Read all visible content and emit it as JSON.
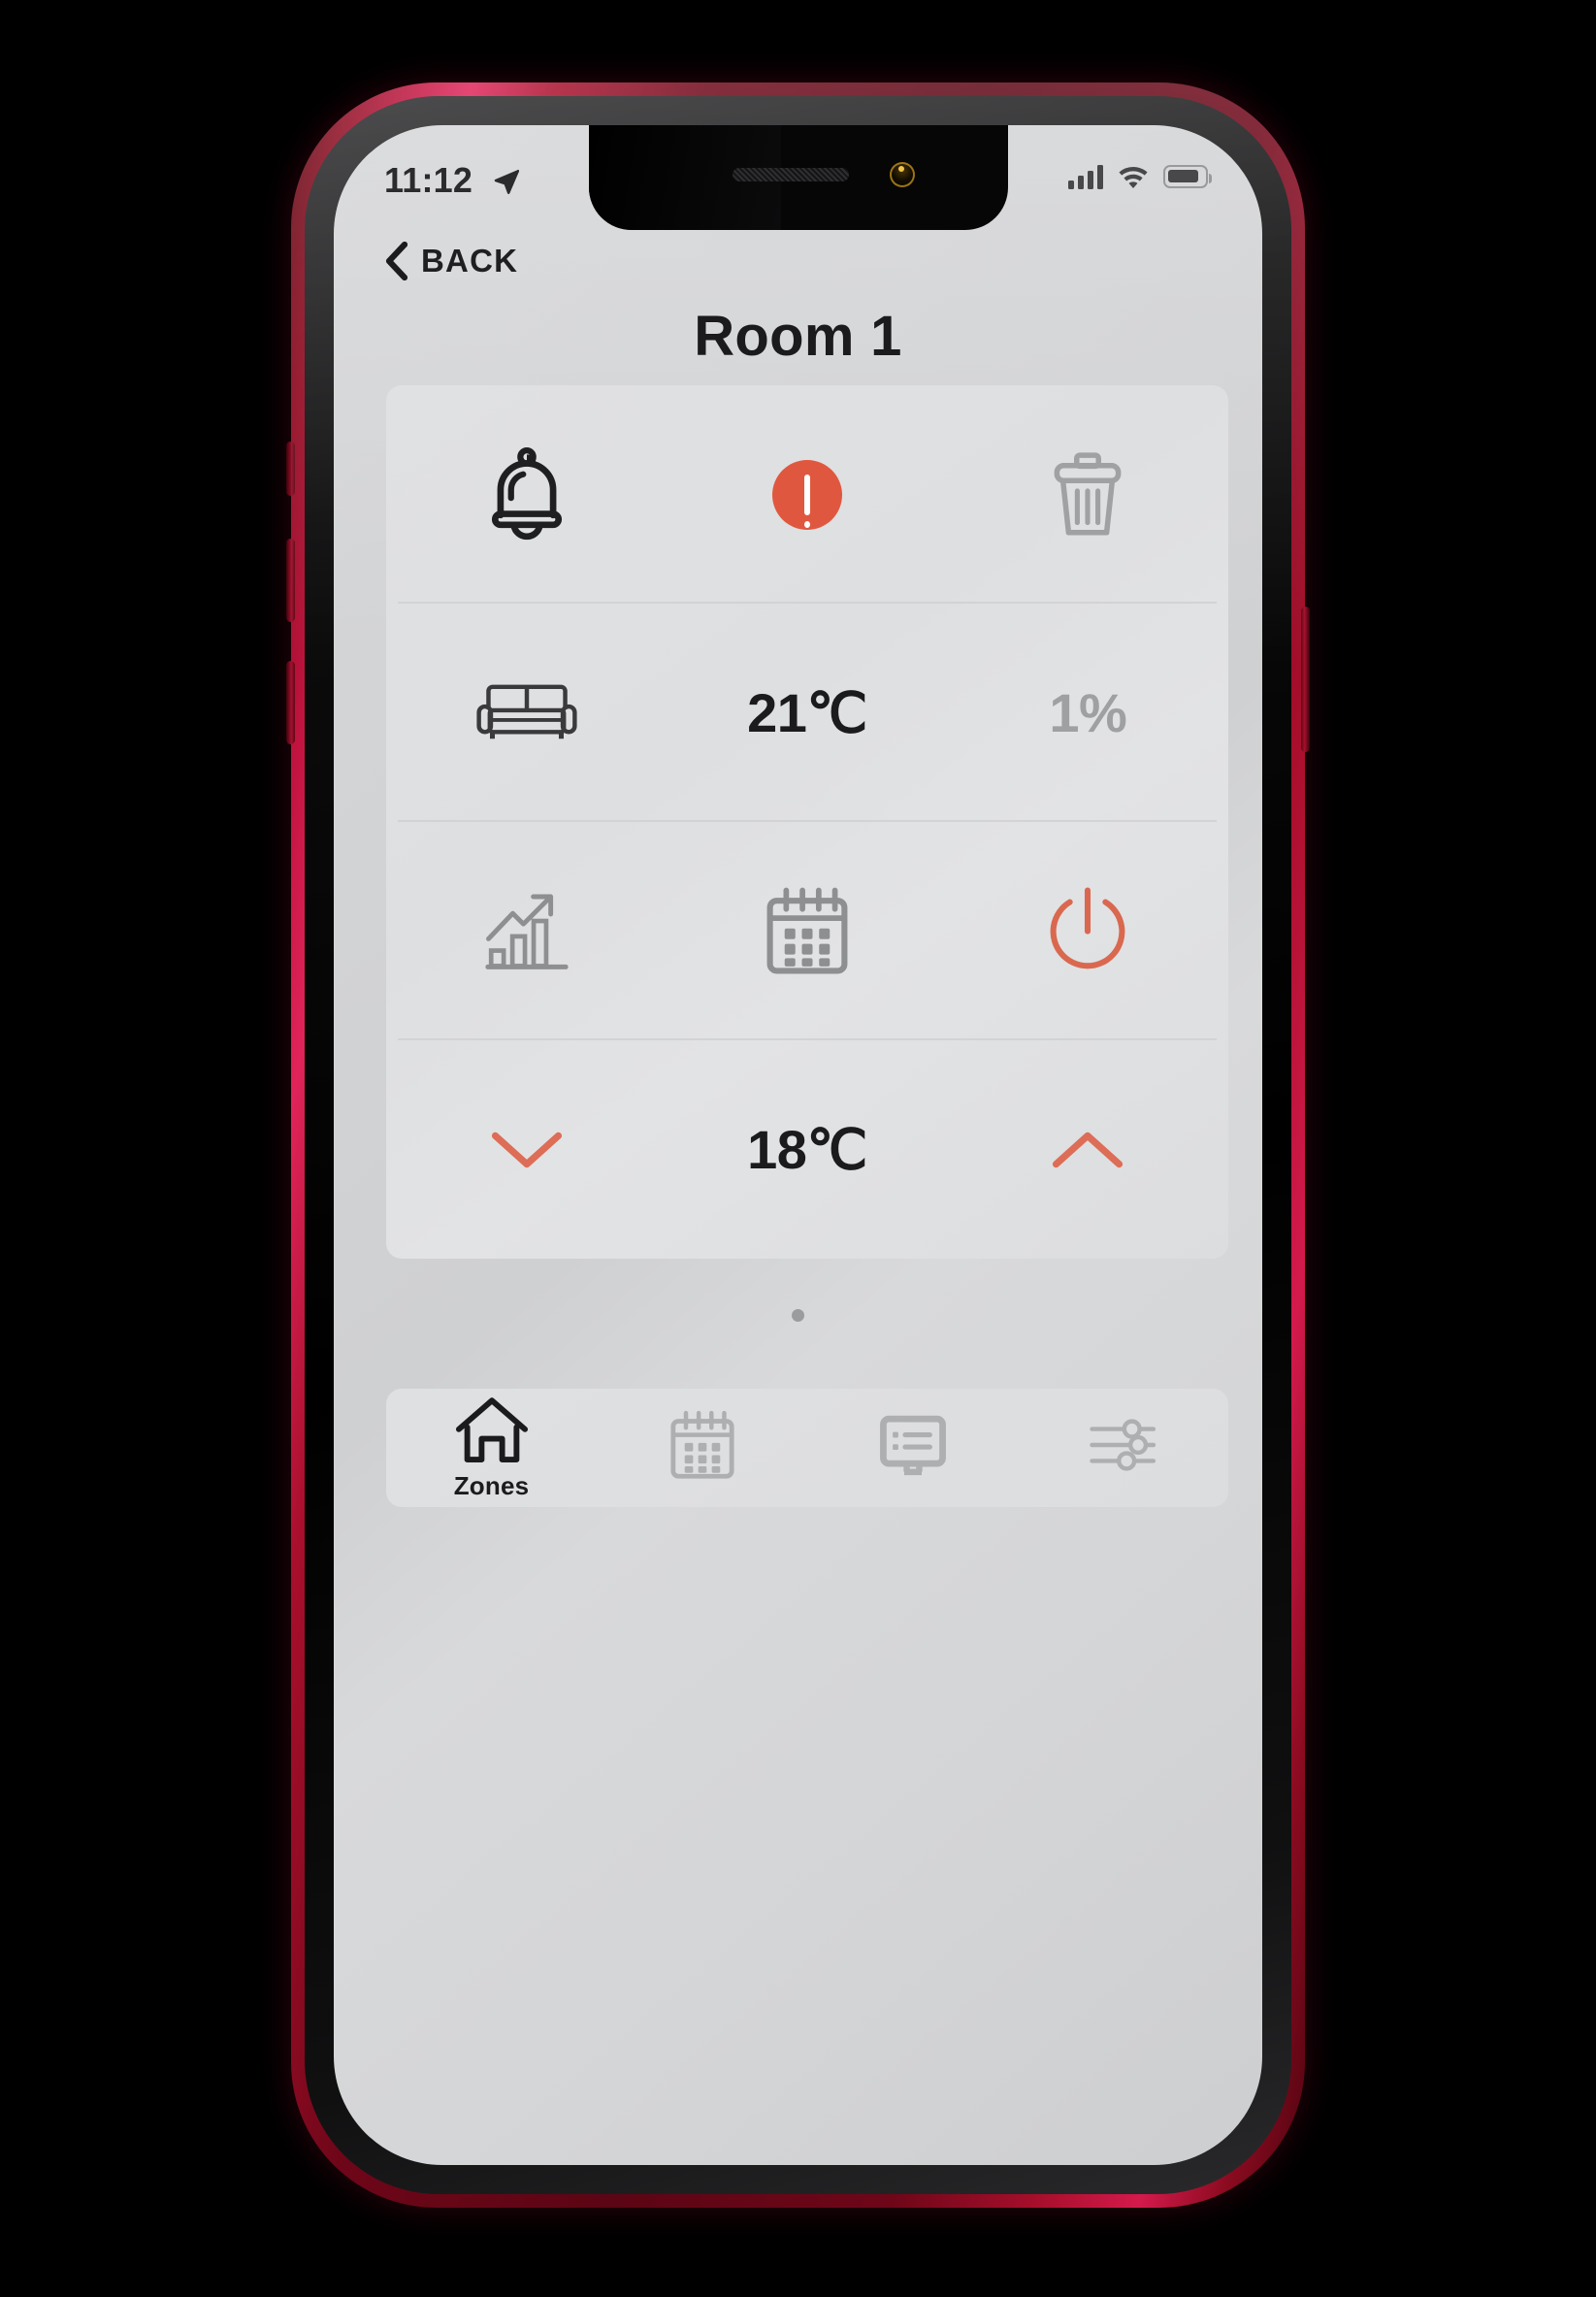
{
  "device": {
    "frame_color": "#8c0b20",
    "screen_bg": "#d4d5d7"
  },
  "status_bar": {
    "time": "11:12",
    "location_icon": "location-arrow-icon",
    "signal_icon": "cellular-signal-icon",
    "signal_bars": 4,
    "wifi_icon": "wifi-icon",
    "battery_icon": "battery-icon",
    "battery_level": 85
  },
  "nav": {
    "back_icon": "chevron-left-icon",
    "back_label": "BACK"
  },
  "header": {
    "title": "Room 1"
  },
  "card": {
    "rows": [
      {
        "name": "alerts-row",
        "cells": [
          {
            "type": "icon",
            "name": "bell-icon",
            "color": "#1f1f21",
            "interactable": true
          },
          {
            "type": "badge",
            "name": "alert-exclamation-icon",
            "color": "#e0573f",
            "interactable": true
          },
          {
            "type": "icon",
            "name": "trash-icon",
            "color": "#a0a1a3",
            "interactable": true
          }
        ]
      },
      {
        "name": "climate-row",
        "cells": [
          {
            "type": "icon",
            "name": "sofa-icon",
            "color": "#3a3a3c",
            "interactable": true
          },
          {
            "type": "value",
            "name": "current-temperature",
            "text": "21℃",
            "style": "strong",
            "interactable": false
          },
          {
            "type": "value",
            "name": "humidity-value",
            "text": "1%",
            "style": "muted",
            "interactable": false
          }
        ]
      },
      {
        "name": "tools-row",
        "cells": [
          {
            "type": "icon",
            "name": "statistics-chart-icon",
            "color": "#8e8f91",
            "interactable": true
          },
          {
            "type": "icon",
            "name": "calendar-icon",
            "color": "#8e8f91",
            "interactable": true
          },
          {
            "type": "icon",
            "name": "power-icon",
            "color": "#d9684f",
            "interactable": true
          }
        ]
      },
      {
        "name": "setpoint-row",
        "cells": [
          {
            "type": "icon",
            "name": "chevron-down-icon",
            "color": "#dd6d56",
            "interactable": true
          },
          {
            "type": "value",
            "name": "target-temperature",
            "text": "18℃",
            "style": "strong",
            "interactable": false
          },
          {
            "type": "icon",
            "name": "chevron-up-icon",
            "color": "#dd6d56",
            "interactable": true
          }
        ]
      }
    ]
  },
  "pagination": {
    "count": 1,
    "active_index": 0
  },
  "tabbar": {
    "items": [
      {
        "name": "tab-zones",
        "icon": "home-icon",
        "label": "Zones",
        "active": true
      },
      {
        "name": "tab-schedule",
        "icon": "calendar-icon",
        "label": "",
        "active": false
      },
      {
        "name": "tab-display",
        "icon": "monitor-icon",
        "label": "",
        "active": false
      },
      {
        "name": "tab-settings",
        "icon": "sliders-icon",
        "label": "",
        "active": false
      }
    ]
  }
}
